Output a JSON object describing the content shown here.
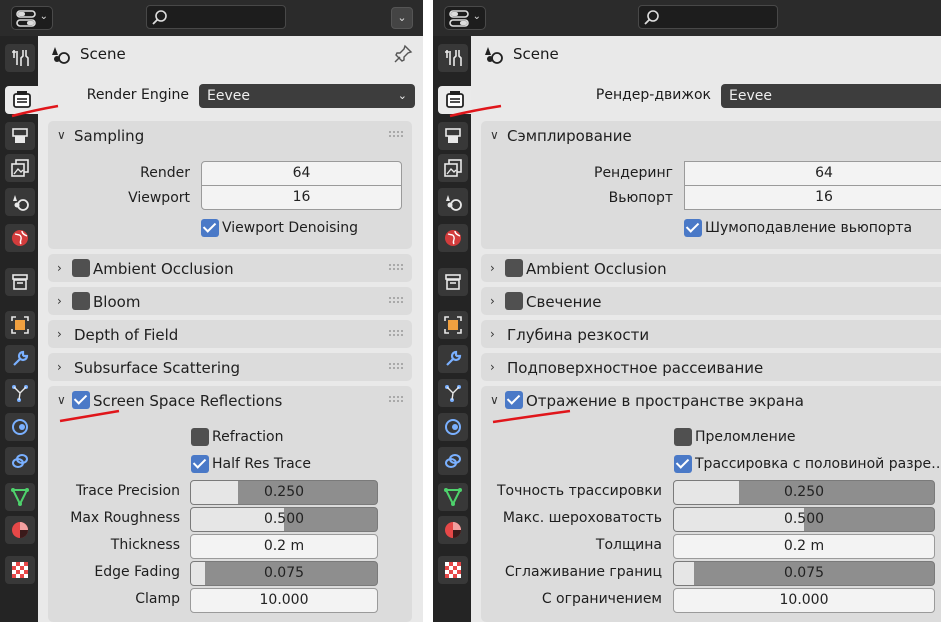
{
  "left": {
    "header": {
      "scene": "Scene"
    },
    "render_engine": {
      "label": "Render Engine",
      "value": "Eevee"
    },
    "sampling": {
      "title": "Sampling",
      "render_label": "Render",
      "render_value": "64",
      "viewport_label": "Viewport",
      "viewport_value": "16",
      "denoise_label": "Viewport Denoising"
    },
    "panels": {
      "ao": "Ambient Occlusion",
      "bloom": "Bloom",
      "dof": "Depth of Field",
      "sss": "Subsurface Scattering",
      "ssr": "Screen Space Reflections"
    },
    "ssr": {
      "refraction": "Refraction",
      "half_res": "Half Res Trace",
      "trace_precision_label": "Trace Precision",
      "trace_precision_value": "0.250",
      "max_roughness_label": "Max Roughness",
      "max_roughness_value": "0.500",
      "thickness_label": "Thickness",
      "thickness_value": "0.2 m",
      "edge_fading_label": "Edge Fading",
      "edge_fading_value": "0.075",
      "clamp_label": "Clamp",
      "clamp_value": "10.000"
    }
  },
  "right": {
    "header": {
      "scene": "Scene"
    },
    "render_engine": {
      "label": "Рендер-движок",
      "value": "Eevee"
    },
    "sampling": {
      "title": "Сэмплирование",
      "render_label": "Рендеринг",
      "render_value": "64",
      "viewport_label": "Вьюпорт",
      "viewport_value": "16",
      "denoise_label": "Шумоподавление вьюпорта"
    },
    "panels": {
      "ao": "Ambient Occlusion",
      "bloom": "Свечение",
      "dof": "Глубина резкости",
      "sss": "Подповерхностное рассеивание",
      "ssr": "Отражение в пространстве экрана"
    },
    "ssr": {
      "refraction": "Преломление",
      "half_res": "Трассировка с половиной разре…",
      "trace_precision_label": "Точность трассировки",
      "trace_precision_value": "0.250",
      "max_roughness_label": "Макс. шероховатость",
      "max_roughness_value": "0.500",
      "thickness_label": "Толщина",
      "thickness_value": "0.2 m",
      "edge_fading_label": "Сглаживание границ",
      "edge_fading_value": "0.075",
      "clamp_label": "С ограничением",
      "clamp_value": "10.000"
    }
  },
  "state": {
    "viewport_denoising": true,
    "ambient_occlusion": false,
    "bloom": false,
    "screen_space_reflections": true,
    "refraction": false,
    "half_res_trace": true,
    "trace_precision_fill": 0.25,
    "max_roughness_fill": 0.5,
    "edge_fading_fill": 0.075
  },
  "colors": {
    "accent": "#4a79c7",
    "annotation": "#e0161b"
  },
  "icons": [
    "editor-type-icon",
    "search-icon",
    "dropdown-icon",
    "scene-icon",
    "pin-icon",
    "tool-tab-icon",
    "render-tab-icon",
    "output-tab-icon",
    "view-layer-tab-icon",
    "scene-tab-icon",
    "world-tab-icon",
    "collection-tab-icon",
    "object-tab-icon",
    "modifier-tab-icon",
    "particles-tab-icon",
    "physics-tab-icon",
    "constraints-tab-icon",
    "data-tab-icon",
    "material-tab-icon",
    "texture-tab-icon"
  ]
}
